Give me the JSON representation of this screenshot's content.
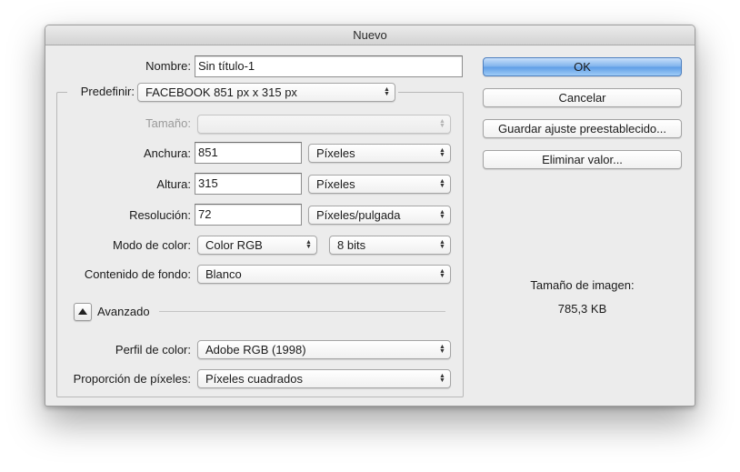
{
  "window": {
    "title": "Nuevo"
  },
  "form": {
    "nombre_label": "Nombre:",
    "nombre_value": "Sin título-1",
    "predefinir_label": "Predefinir:",
    "predefinir_value": "FACEBOOK 851 px x 315 px",
    "tamano_label": "Tamaño:",
    "tamano_value": "",
    "anchura_label": "Anchura:",
    "anchura_value": "851",
    "anchura_unit": "Píxeles",
    "altura_label": "Altura:",
    "altura_value": "315",
    "altura_unit": "Píxeles",
    "resolucion_label": "Resolución:",
    "resolucion_value": "72",
    "resolucion_unit": "Píxeles/pulgada",
    "modo_label": "Modo de color:",
    "modo_value": "Color RGB",
    "bits_value": "8 bits",
    "fondo_label": "Contenido de fondo:",
    "fondo_value": "Blanco",
    "avanzado_label": "Avanzado",
    "perfil_label": "Perfil de color:",
    "perfil_value": "Adobe RGB (1998)",
    "proporcion_label": "Proporción de píxeles:",
    "proporcion_value": "Píxeles cuadrados"
  },
  "buttons": {
    "ok": "OK",
    "cancel": "Cancelar",
    "save_preset": "Guardar ajuste preestablecido...",
    "delete_value": "Eliminar valor..."
  },
  "info": {
    "size_label": "Tamaño de imagen:",
    "size_value": "785,3 KB"
  },
  "colors": {
    "default_button": "#6aa7ea",
    "window_bg": "#ececec"
  }
}
